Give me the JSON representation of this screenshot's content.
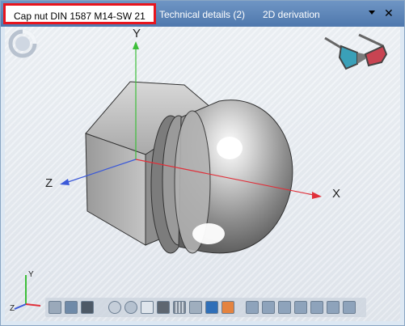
{
  "tabs": [
    {
      "label": "Cap nut DIN 1587 M14-SW 21",
      "active": true
    },
    {
      "label": "Technical details (2)",
      "active": false
    },
    {
      "label": "2D derivation",
      "active": false
    }
  ],
  "axes": {
    "x": "X",
    "y": "Y",
    "z": "Z"
  },
  "mini_axes": {
    "y": "Y",
    "z": "Z"
  },
  "icons": {
    "spin": "spinner-icon",
    "glasses": "3d-glasses-icon",
    "menu": "chevron-down-icon",
    "close": "close-icon"
  },
  "colors": {
    "highlight": "#e8141d",
    "tab_bg": "#5a82b6",
    "x_axis": "#e0303a",
    "y_axis": "#3dbf3a",
    "z_axis": "#3b59d8"
  },
  "toolbar": [
    "view-cylinder-icon",
    "view-cylinder-dark-icon",
    "view-box-icon",
    "zoom-icon",
    "zoom-window-icon",
    "rotate-icon",
    "grid-view-icon",
    "mesh-view-icon",
    "section-icon",
    "color-icon",
    "box-dark-icon",
    "view-front-icon",
    "view-back-icon",
    "view-left-icon",
    "view-right-icon",
    "view-top-icon",
    "view-bottom-icon",
    "view-iso-icon"
  ]
}
